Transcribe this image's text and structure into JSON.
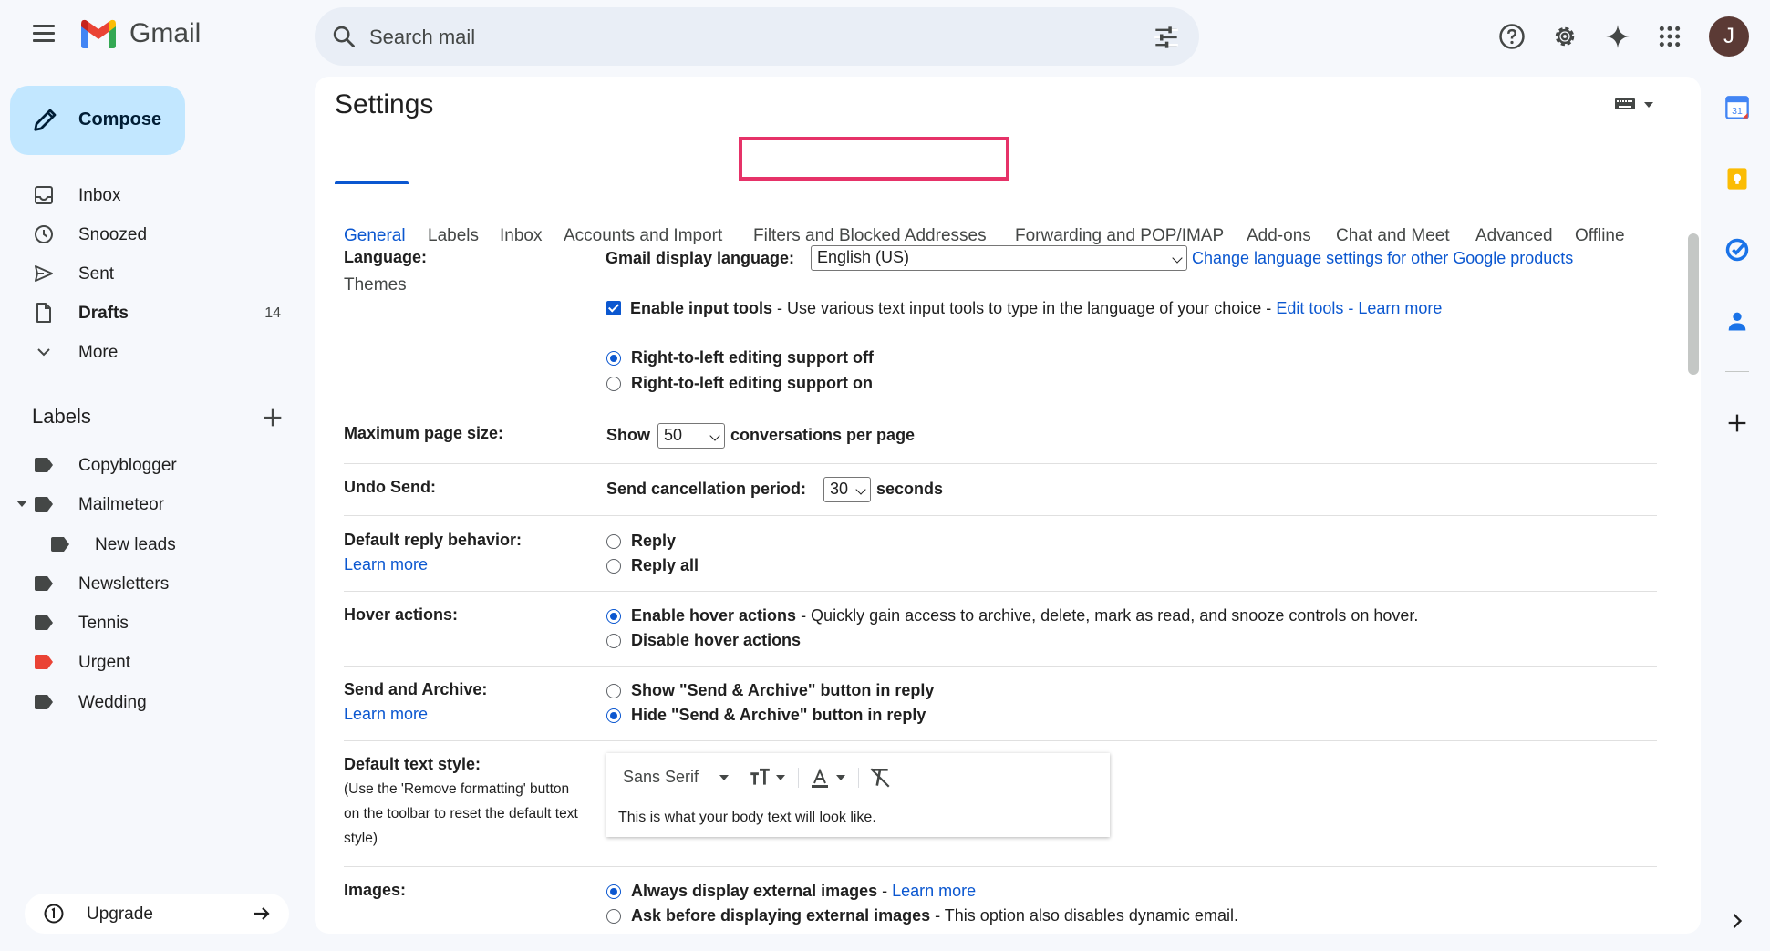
{
  "app": {
    "name": "Gmail"
  },
  "search": {
    "placeholder": "Search mail"
  },
  "user": {
    "avatar_letter": "J"
  },
  "compose": {
    "label": "Compose"
  },
  "nav": [
    {
      "label": "Inbox",
      "icon": "inbox-icon",
      "count": ""
    },
    {
      "label": "Snoozed",
      "icon": "clock-icon",
      "count": ""
    },
    {
      "label": "Sent",
      "icon": "send-icon",
      "count": ""
    },
    {
      "label": "Drafts",
      "icon": "draft-icon",
      "count": "14"
    },
    {
      "label": "More",
      "icon": "chevron-down-icon",
      "count": ""
    }
  ],
  "labels": {
    "heading": "Labels",
    "items": [
      {
        "label": "Copyblogger",
        "color": "#444746"
      },
      {
        "label": "Mailmeteor",
        "color": "#444746"
      },
      {
        "label": "New leads",
        "color": "#444746"
      },
      {
        "label": "Newsletters",
        "color": "#444746"
      },
      {
        "label": "Tennis",
        "color": "#444746"
      },
      {
        "label": "Urgent",
        "color": "#ea4335"
      },
      {
        "label": "Wedding",
        "color": "#444746"
      }
    ]
  },
  "upgrade": {
    "label": "Upgrade"
  },
  "settings": {
    "title": "Settings",
    "tabs": [
      "General",
      "Labels",
      "Inbox",
      "Accounts and Import",
      "Filters and Blocked Addresses",
      "Forwarding and POP/IMAP",
      "Add-ons",
      "Chat and Meet",
      "Advanced",
      "Offline",
      "Themes"
    ],
    "active_tab": "General",
    "highlighted_tab": "Filters and Blocked Addresses",
    "language": {
      "label": "Language:",
      "display_label": "Gmail display language:",
      "display_value": "English (US)",
      "change_link": "Change language settings for other Google products",
      "input_tools_label": "Enable input tools",
      "input_tools_desc": " - Use various text input tools to type in the language of your choice - ",
      "edit_tools": "Edit tools",
      "dash": " - ",
      "learn_more": "Learn more",
      "rtl_off": "Right-to-left editing support off",
      "rtl_on": "Right-to-left editing support on"
    },
    "page_size": {
      "label": "Maximum page size:",
      "show": "Show",
      "value": "50",
      "suffix": "conversations per page"
    },
    "undo_send": {
      "label": "Undo Send:",
      "prefix": "Send cancellation period:",
      "value": "30",
      "suffix": "seconds"
    },
    "reply": {
      "label": "Default reply behavior:",
      "learn_more": "Learn more",
      "opt1": "Reply",
      "opt2": "Reply all"
    },
    "hover": {
      "label": "Hover actions:",
      "opt1": "Enable hover actions",
      "opt1_desc": " - Quickly gain access to archive, delete, mark as read, and snooze controls on hover.",
      "opt2": "Disable hover actions"
    },
    "send_archive": {
      "label": "Send and Archive:",
      "learn_more": "Learn more",
      "opt1": "Show \"Send & Archive\" button in reply",
      "opt2": "Hide \"Send & Archive\" button in reply"
    },
    "text_style": {
      "label": "Default text style:",
      "note1": "(Use the 'Remove formatting' button",
      "note2": "on the toolbar to reset the default text",
      "note3": "style)",
      "font": "Sans Serif",
      "sample": "This is what your body text will look like."
    },
    "images": {
      "label": "Images:",
      "opt1": "Always display external images",
      "opt1_sep": " - ",
      "learn_more": "Learn more",
      "opt2": "Ask before displaying external images",
      "opt2_desc": " - This option also disables dynamic email."
    }
  },
  "colors": {
    "accent": "#0b57d0",
    "highlight": "#e63268",
    "compose_bg": "#c2e7ff"
  }
}
